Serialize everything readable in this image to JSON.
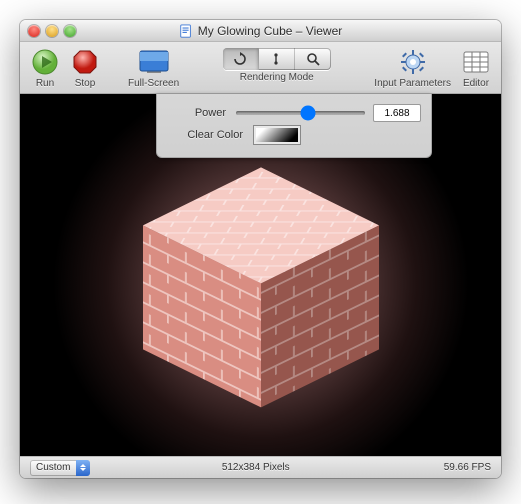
{
  "window": {
    "title": "My Glowing Cube – Viewer"
  },
  "toolbar": {
    "run": "Run",
    "stop": "Stop",
    "fullscreen": "Full-Screen",
    "rendering_mode": "Rendering Mode",
    "input_parameters": "Input Parameters",
    "editor": "Editor"
  },
  "overlay": {
    "power_label": "Power",
    "power_value": "1.688",
    "clear_color_label": "Clear Color"
  },
  "status": {
    "popup": "Custom",
    "dimensions": "512x384 Pixels",
    "fps": "59.66 FPS"
  },
  "colors": {
    "cube_face_light": "#f3b7ae",
    "cube_face_mid": "#d98d82",
    "cube_face_dark": "#b76a5f",
    "mortar": "#f8d8d4"
  }
}
